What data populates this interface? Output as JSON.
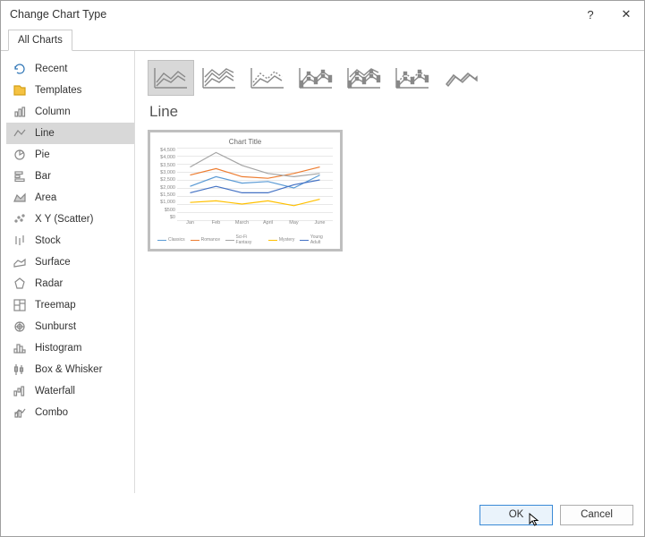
{
  "dialog": {
    "title": "Change Chart Type",
    "help": "?",
    "close": "✕"
  },
  "tab": {
    "label": "All Charts"
  },
  "categories": [
    {
      "label": "Recent",
      "icon": "recent-icon"
    },
    {
      "label": "Templates",
      "icon": "templates-icon"
    },
    {
      "label": "Column",
      "icon": "column-icon"
    },
    {
      "label": "Line",
      "icon": "line-icon",
      "selected": true
    },
    {
      "label": "Pie",
      "icon": "pie-icon"
    },
    {
      "label": "Bar",
      "icon": "bar-icon"
    },
    {
      "label": "Area",
      "icon": "area-icon"
    },
    {
      "label": "X Y (Scatter)",
      "icon": "scatter-icon"
    },
    {
      "label": "Stock",
      "icon": "stock-icon"
    },
    {
      "label": "Surface",
      "icon": "surface-icon"
    },
    {
      "label": "Radar",
      "icon": "radar-icon"
    },
    {
      "label": "Treemap",
      "icon": "treemap-icon"
    },
    {
      "label": "Sunburst",
      "icon": "sunburst-icon"
    },
    {
      "label": "Histogram",
      "icon": "histogram-icon"
    },
    {
      "label": "Box & Whisker",
      "icon": "boxwhisker-icon"
    },
    {
      "label": "Waterfall",
      "icon": "waterfall-icon"
    },
    {
      "label": "Combo",
      "icon": "combo-icon"
    }
  ],
  "subtype_count": 7,
  "subtype_selected_index": 0,
  "type_title": "Line",
  "buttons": {
    "ok": "OK",
    "cancel": "Cancel"
  },
  "chart_data": {
    "type": "line",
    "title": "Chart Title",
    "xlabel": "",
    "ylabel": "",
    "ylim": [
      0,
      4500
    ],
    "yticks": [
      "$4,500",
      "$4,000",
      "$3,500",
      "$3,000",
      "$2,500",
      "$2,000",
      "$1,500",
      "$1,000",
      "$500",
      "$0"
    ],
    "categories": [
      "Jan",
      "Feb",
      "March",
      "April",
      "May",
      "June"
    ],
    "series": [
      {
        "name": "Classics",
        "color": "#5b9bd5",
        "values": [
          2100,
          2700,
          2300,
          2400,
          2000,
          2800
        ]
      },
      {
        "name": "Romance",
        "color": "#ed7d31",
        "values": [
          2800,
          3200,
          2700,
          2600,
          2900,
          3300
        ]
      },
      {
        "name": "Sci-Fi Fantasy",
        "color": "#a5a5a5",
        "values": [
          3300,
          4200,
          3400,
          2900,
          2700,
          2900
        ]
      },
      {
        "name": "Mystery",
        "color": "#ffc000",
        "values": [
          1100,
          1200,
          1000,
          1200,
          900,
          1300
        ]
      },
      {
        "name": "Young Adult",
        "color": "#4472c4",
        "values": [
          1700,
          2100,
          1700,
          1700,
          2200,
          2500
        ]
      }
    ]
  }
}
